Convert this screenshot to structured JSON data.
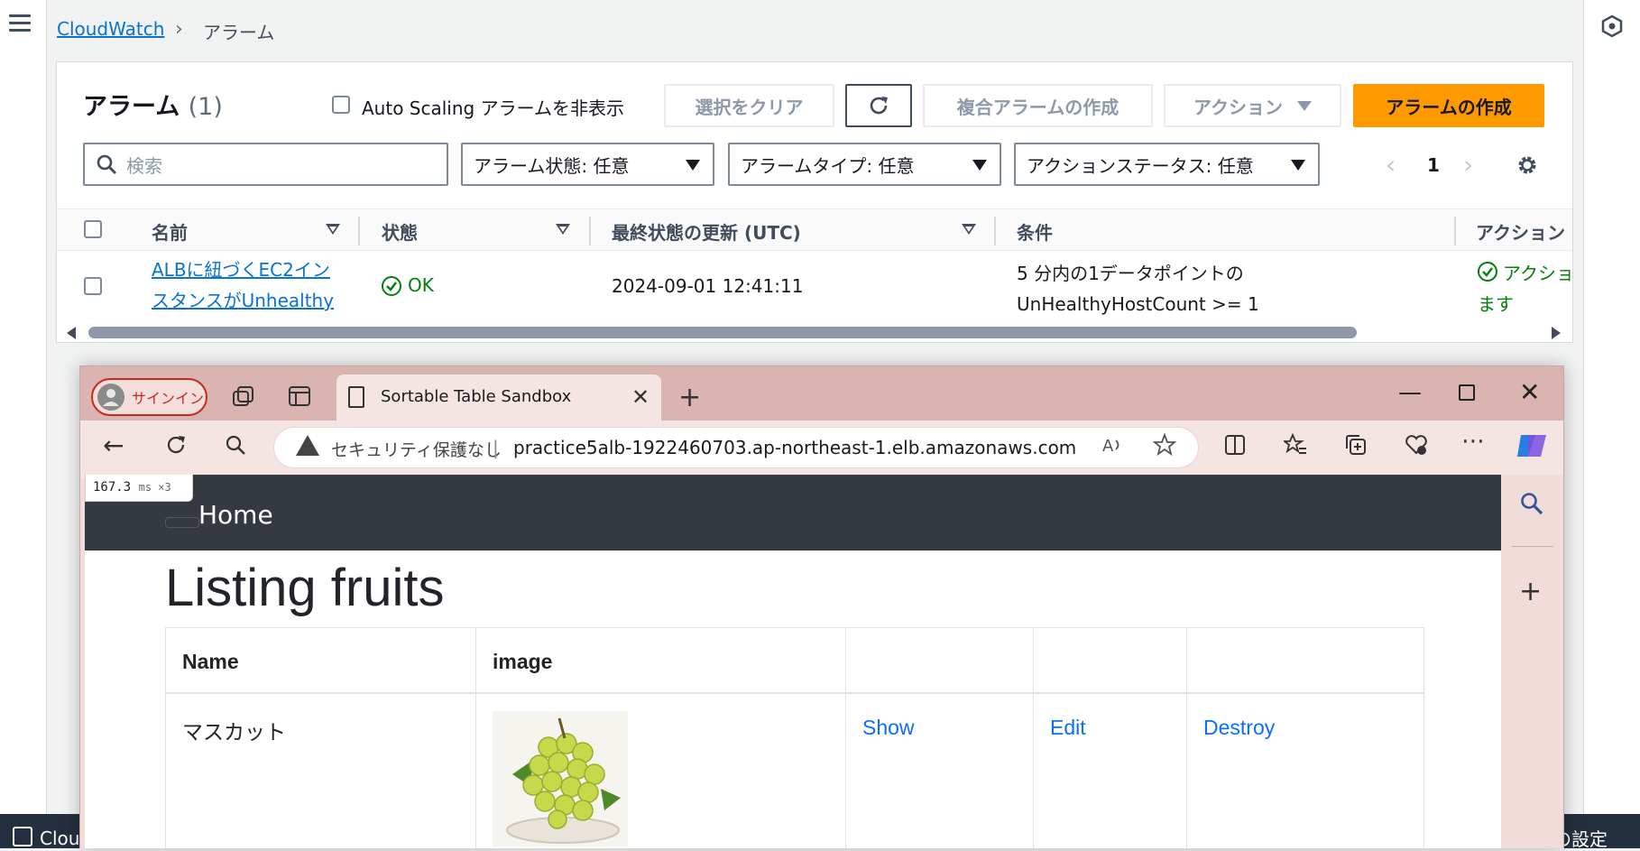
{
  "aws": {
    "breadcrumb": {
      "root": "CloudWatch",
      "current": "アラーム"
    },
    "panel": {
      "title": "アラーム",
      "count": "(1)",
      "hide_autoscaling_label": "Auto Scaling アラームを非表示",
      "buttons": {
        "clear_selection": "選択をクリア",
        "composite": "複合アラームの作成",
        "actions": "アクション",
        "create": "アラームの作成"
      },
      "search_placeholder": "検索",
      "filters": {
        "state": "アラーム状態: 任意",
        "type": "アラームタイプ: 任意",
        "action_status": "アクションステータス: 任意"
      },
      "pager": {
        "page": "1"
      },
      "columns": [
        "名前",
        "状態",
        "最終状態の更新 (UTC)",
        "条件",
        "アクション"
      ],
      "rows": [
        {
          "name_line1": "ALBに紐づくEC2イン",
          "name_line2": "スタンスがUnhealthy",
          "state": "OK",
          "updated": "2024-09-01 12:41:11",
          "condition_line1": "5 分内の1データポイントの",
          "condition_line2": "UnHealthyHostCount >= 1",
          "action_line1": "アクショ",
          "action_line2": "ます"
        }
      ]
    },
    "bottom": {
      "left_text": "Cloud",
      "right_text": "の設定"
    }
  },
  "browser": {
    "signin": "サインイン",
    "tab_title": "Sortable Table Sandbox",
    "security_warning": "セキュリティ保護なし",
    "address_separator": "|",
    "url": "practice5alb-1922460703.ap-northeast-1.elb.amazonaws.com",
    "perf_value": "167.3",
    "perf_unit": "ms ×3"
  },
  "page": {
    "nav_home": "Home",
    "heading": "Listing fruits",
    "table": {
      "headers": [
        "Name",
        "image",
        "",
        "",
        ""
      ],
      "rows": [
        {
          "name": "マスカット",
          "show": "Show",
          "edit": "Edit",
          "destroy": "Destroy"
        }
      ]
    }
  },
  "colors": {
    "aws_link": "#0972d3",
    "aws_primary": "#ff9900",
    "ok_green": "#037f0c",
    "navbar": "#343a40",
    "browser_frame": "#d9b4b0"
  }
}
